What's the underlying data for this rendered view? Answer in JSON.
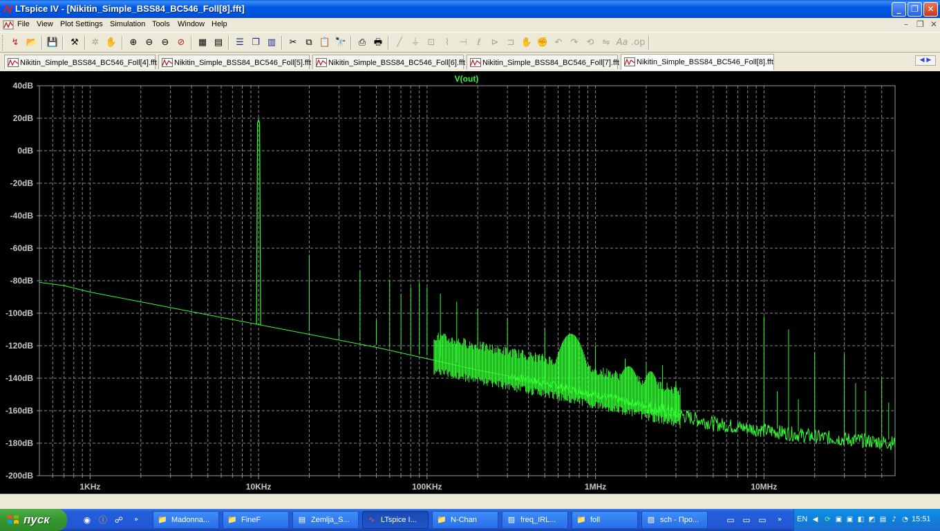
{
  "window": {
    "title": "LTspice IV - [Nikitin_Simple_BSS84_BC546_Foll[8].fft]",
    "controls": [
      "minimize",
      "restore",
      "close"
    ]
  },
  "menu": [
    "File",
    "View",
    "Plot Settings",
    "Simulation",
    "Tools",
    "Window",
    "Help"
  ],
  "toolbar": {
    "buttons": [
      "run",
      "open",
      "save",
      "control-panel",
      "autorange",
      "pan",
      "zoom-in",
      "zoom-out",
      "zoom-back",
      "zoom-extents",
      "delete-trace",
      "new-pane",
      "tile-horizontal",
      "tile-vertical",
      "cascade",
      "cut",
      "copy",
      "paste",
      "find",
      "print-preview",
      "print",
      "wire",
      "ground",
      "label-net",
      "resistor",
      "capacitor",
      "inductor",
      "diode",
      "component",
      "move",
      "drag",
      "undo",
      "redo",
      "rotate",
      "mirror",
      "text",
      "spice-directive"
    ]
  },
  "tabs": [
    {
      "label": "Nikitin_Simple_BSS84_BC546_Foll[4].fft",
      "active": false
    },
    {
      "label": "Nikitin_Simple_BSS84_BC546_Foll[5].fft",
      "active": false
    },
    {
      "label": "Nikitin_Simple_BSS84_BC546_Foll[6].fft",
      "active": false
    },
    {
      "label": "Nikitin_Simple_BSS84_BC546_Foll[7].fft",
      "active": false
    },
    {
      "label": "Nikitin_Simple_BSS84_BC546_Foll[8].fft",
      "active": true
    }
  ],
  "chart_data": {
    "type": "line",
    "title": "V(out)",
    "xlabel": "",
    "ylabel": "",
    "x_scale": "log",
    "x_unit": "Hz",
    "xlim": [
      500,
      60000000
    ],
    "ylim": [
      -200,
      40
    ],
    "x_ticks": [
      {
        "value": 1000,
        "label": "1KHz"
      },
      {
        "value": 10000,
        "label": "10KHz"
      },
      {
        "value": 100000,
        "label": "100KHz"
      },
      {
        "value": 1000000,
        "label": "1MHz"
      },
      {
        "value": 10000000,
        "label": "10MHz"
      }
    ],
    "y_ticks": [
      {
        "value": 40,
        "label": "40dB"
      },
      {
        "value": 20,
        "label": "20dB"
      },
      {
        "value": 0,
        "label": "0dB"
      },
      {
        "value": -20,
        "label": "-20dB"
      },
      {
        "value": -40,
        "label": "-40dB"
      },
      {
        "value": -60,
        "label": "-60dB"
      },
      {
        "value": -80,
        "label": "-80dB"
      },
      {
        "value": -100,
        "label": "-100dB"
      },
      {
        "value": -120,
        "label": "-120dB"
      },
      {
        "value": -140,
        "label": "-140dB"
      },
      {
        "value": -160,
        "label": "-160dB"
      },
      {
        "value": -180,
        "label": "-180dB"
      },
      {
        "value": -200,
        "label": "-200dB"
      }
    ],
    "grid": true,
    "grid_style": "dashed",
    "background": "#000000",
    "trace_color": "#33ff33",
    "series": [
      {
        "name": "V(out)",
        "noise_floor": [
          [
            500,
            -81
          ],
          [
            700,
            -83
          ],
          [
            1000,
            -87
          ],
          [
            2000,
            -93
          ],
          [
            5000,
            -101
          ],
          [
            10000,
            -107
          ],
          [
            20000,
            -113
          ],
          [
            50000,
            -121
          ],
          [
            100000,
            -128
          ],
          [
            200000,
            -135
          ],
          [
            500000,
            -143
          ],
          [
            1000000,
            -150
          ],
          [
            2000000,
            -157
          ],
          [
            5000000,
            -168
          ],
          [
            10000000,
            -172
          ],
          [
            20000000,
            -176
          ],
          [
            60000000,
            -180
          ]
        ],
        "harmonics": [
          [
            10000,
            19
          ],
          [
            20000,
            -64
          ],
          [
            30000,
            -110
          ],
          [
            40000,
            -74
          ],
          [
            50000,
            -104
          ],
          [
            60000,
            -80
          ],
          [
            70000,
            -88
          ],
          [
            80000,
            -84
          ],
          [
            90000,
            -81
          ],
          [
            100000,
            -84
          ],
          [
            120000,
            -88
          ],
          [
            150000,
            -93
          ],
          [
            200000,
            -97
          ],
          [
            300000,
            -103
          ],
          [
            500000,
            -109
          ],
          [
            700000,
            -117
          ],
          [
            1000000,
            -120
          ],
          [
            1500000,
            -128
          ],
          [
            2000000,
            -130
          ],
          [
            2500000,
            -132
          ],
          [
            3000000,
            -142
          ],
          [
            10000000,
            -102
          ],
          [
            12000000,
            -148
          ],
          [
            14000000,
            -110
          ],
          [
            16000000,
            -153
          ],
          [
            20000000,
            -124
          ],
          [
            30000000,
            -125
          ],
          [
            35000000,
            -143
          ],
          [
            40000000,
            -148
          ],
          [
            50000000,
            -140
          ],
          [
            55000000,
            -155
          ]
        ]
      }
    ]
  },
  "taskbar": {
    "start_label": "пуск",
    "quicklaunch": [
      "chrome-icon",
      "info-icon",
      "network-icon"
    ],
    "tasks": [
      {
        "label": "Madonna...",
        "icon": "folder-icon",
        "active": false
      },
      {
        "label": "FineF",
        "icon": "folder-icon",
        "active": false
      },
      {
        "label": "Zemlja_S...",
        "icon": "document-icon",
        "active": false
      },
      {
        "label": "LTspice I...",
        "icon": "ltspice-icon",
        "active": true
      },
      {
        "label": "N-Chan",
        "icon": "folder-icon",
        "active": false
      },
      {
        "label": "freq_IRL...",
        "icon": "image-icon",
        "active": false
      },
      {
        "label": "foll",
        "icon": "folder-icon",
        "active": false
      },
      {
        "label": "sch - Про...",
        "icon": "image-icon",
        "active": false
      }
    ],
    "language": "EN",
    "clock": "15:51"
  }
}
